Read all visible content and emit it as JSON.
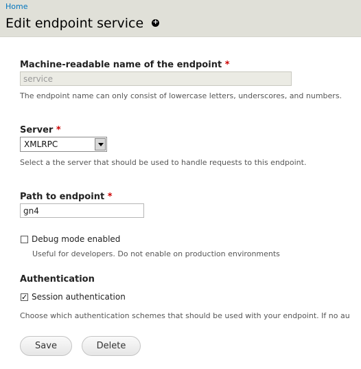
{
  "header": {
    "breadcrumb": "Home",
    "title": "Edit endpoint service",
    "shortcut_icon": "add-shortcut-icon"
  },
  "form": {
    "machine_name": {
      "label": "Machine-readable name of the endpoint",
      "required": "*",
      "value": "service",
      "description": "The endpoint name can only consist of lowercase letters, underscores, and numbers."
    },
    "server": {
      "label": "Server",
      "required": "*",
      "selected": "XMLRPC",
      "description": "Select a the server that should be used to handle requests to this endpoint."
    },
    "path": {
      "label": "Path to endpoint",
      "required": "*",
      "value": "gn4"
    },
    "debug": {
      "label": "Debug mode enabled",
      "checked": false,
      "description": "Useful for developers. Do not enable on production environments"
    },
    "authentication": {
      "title": "Authentication",
      "session_label": "Session authentication",
      "session_checked": true,
      "description": "Choose which authentication schemes that should be used with your endpoint. If no au"
    }
  },
  "actions": {
    "save_label": "Save",
    "delete_label": "Delete"
  },
  "colors": {
    "header_bg": "#e0e0d8",
    "link": "#0074bd",
    "required": "#cc0000"
  }
}
